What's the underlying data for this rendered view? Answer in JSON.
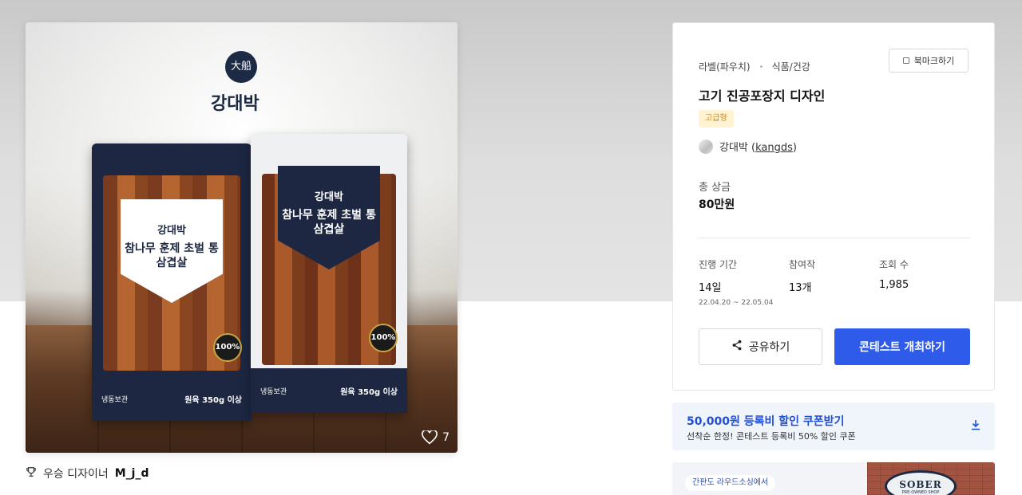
{
  "product_image": {
    "brand_name": "강대박",
    "seal_text": "大船",
    "package_name": "참나무 훈제 초벌 통 삼겹살",
    "package_storage": "냉동보관",
    "package_weight": "원육 350g 이상",
    "quality_badge": "100%",
    "like_count": "7"
  },
  "winner": {
    "label": "우승 디자이너",
    "name": "M_j_d"
  },
  "contest": {
    "category_primary": "라벨(파우치)",
    "category_secondary": "식품/건강",
    "bookmark_label": "북마크하기",
    "title": "고기 진공포장지 디자인",
    "tier_badge": "고급형",
    "host_name": "강대박",
    "host_id": "kangds",
    "prize_label": "총 상금",
    "prize_value": "80만원",
    "stats": {
      "duration_label": "진행 기간",
      "duration_value": "14일",
      "duration_range": "22.04.20  ~  22.05.04",
      "entries_label": "참여작",
      "entries_value": "13개",
      "views_label": "조회 수",
      "views_value": "1,985"
    },
    "share_label": "공유하기",
    "host_button_label": "콘테스트 개최하기"
  },
  "coupon": {
    "title": "50,000원 등록비 할인 쿠폰받기",
    "subtitle": "선착순 한정! 콘테스트 등록비 50% 할인 쿠폰"
  },
  "promo": {
    "chip": "간판도 라우드소싱에서",
    "sign_title": "SOBER",
    "sign_sub": "PRE-OWNED SHOP"
  },
  "colors": {
    "primary": "#2f5bea",
    "coupon_text": "#1f4fd6",
    "tier_badge_bg": "#fff3d1",
    "tier_badge_text": "#d4851b"
  },
  "icons": [
    "heart-icon",
    "trophy-icon",
    "bookmark-icon",
    "share-icon",
    "download-icon"
  ]
}
